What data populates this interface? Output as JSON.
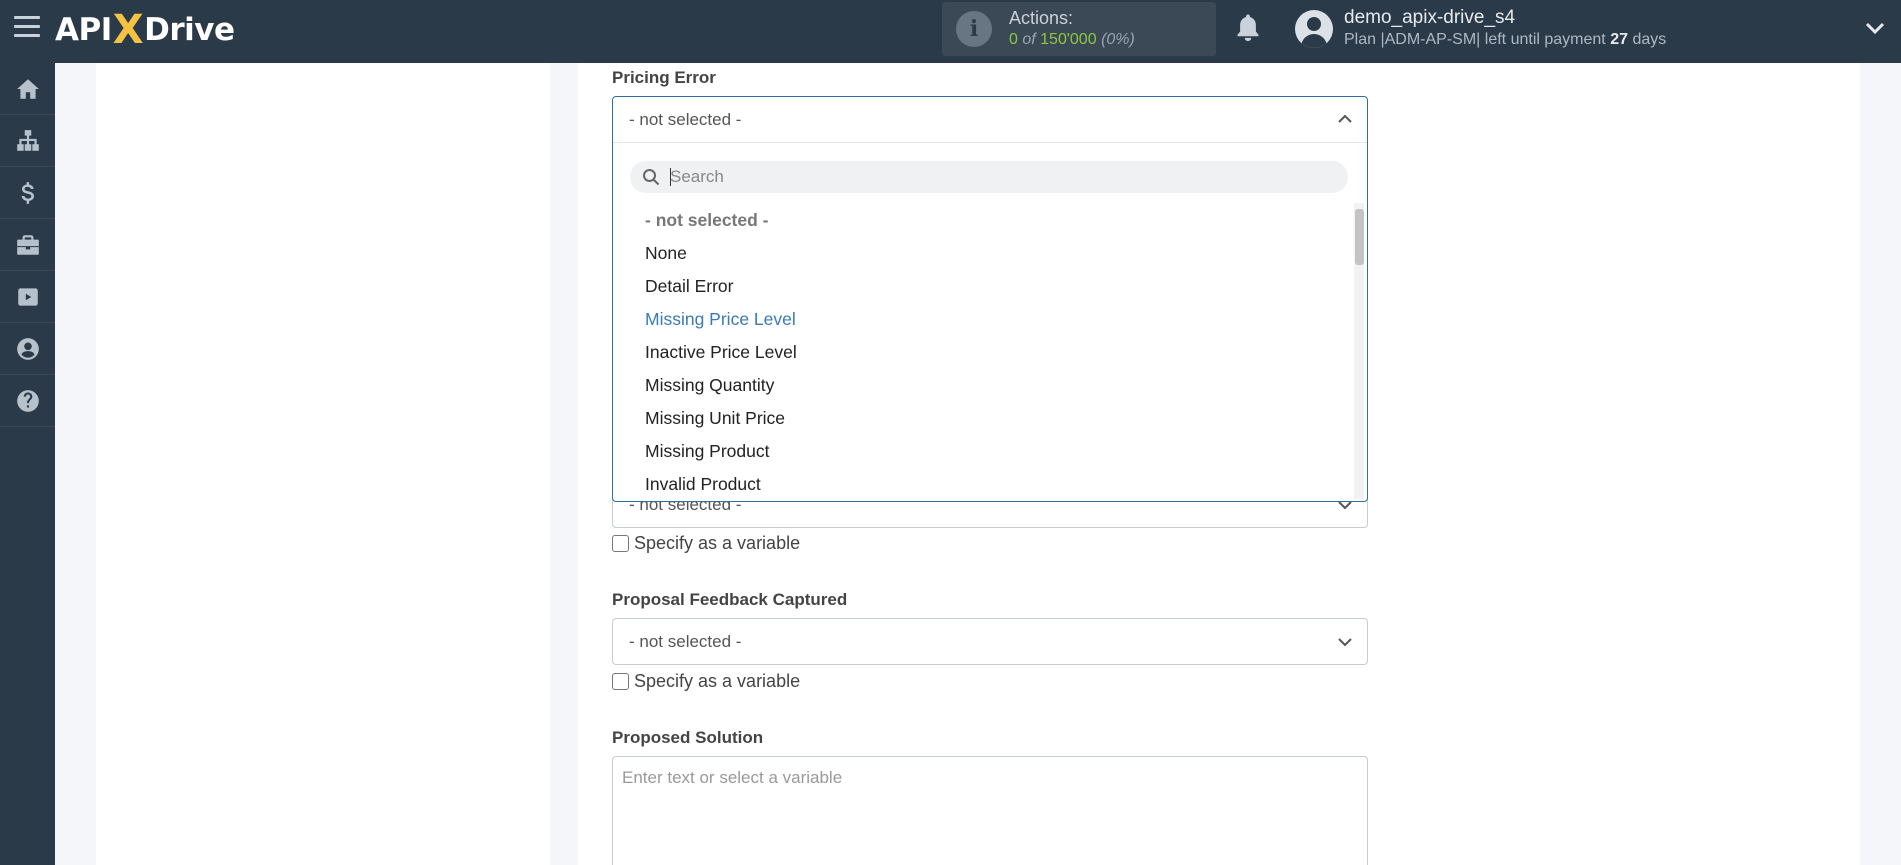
{
  "header": {
    "logo_left": "API",
    "logo_x": "X",
    "logo_right": "Drive",
    "actions_label": "Actions:",
    "actions_used": "0",
    "actions_of": "of",
    "actions_total": "150'000",
    "actions_percent": "(0%)",
    "username": "demo_apix-drive_s4",
    "plan_prefix": "Plan |ADM-AP-SM| left until payment",
    "plan_days": "27",
    "plan_suffix": "days"
  },
  "sidebar": {
    "items": [
      {
        "icon": "home-icon"
      },
      {
        "icon": "sitemap-icon"
      },
      {
        "icon": "dollar-icon"
      },
      {
        "icon": "briefcase-icon"
      },
      {
        "icon": "youtube-icon"
      },
      {
        "icon": "user-circle-icon"
      },
      {
        "icon": "question-circle-icon"
      }
    ]
  },
  "form": {
    "pricing_error": {
      "label": "Pricing Error",
      "value": "- not selected -"
    },
    "dropdown": {
      "search_placeholder": "Search",
      "options": [
        "- not selected -",
        "None",
        "Detail Error",
        "Missing Price Level",
        "Inactive Price Level",
        "Missing Quantity",
        "Missing Unit Price",
        "Missing Product",
        "Invalid Product"
      ],
      "hovered_option": "Missing Price Level"
    },
    "hidden_field": {
      "value": "- not selected -",
      "checkbox_label": "Specify as a variable"
    },
    "proposal_feedback": {
      "label": "Proposal Feedback Captured",
      "value": "- not selected -",
      "checkbox_label": "Specify as a variable"
    },
    "proposed_solution": {
      "label": "Proposed Solution",
      "placeholder": "Enter text or select a variable"
    }
  },
  "colors": {
    "topbar": "#2b3a48",
    "accent_green": "#8dc63f",
    "logo_x": "#f5c342",
    "link_blue": "#3a7ab5",
    "focus_border": "#2f6fa8"
  }
}
